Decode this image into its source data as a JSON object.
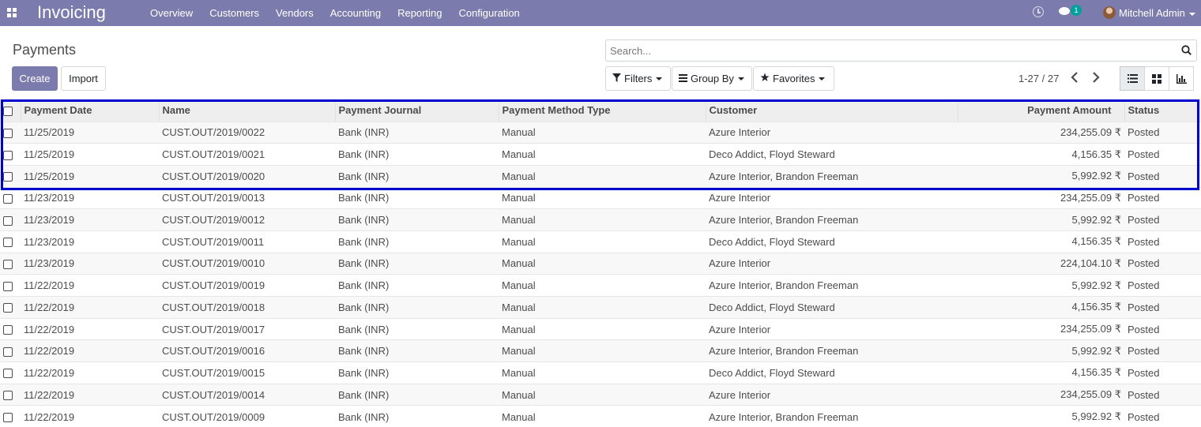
{
  "navbar": {
    "app_title": "Invoicing",
    "menu": [
      "Overview",
      "Customers",
      "Vendors",
      "Accounting",
      "Reporting",
      "Configuration"
    ],
    "chat_badge": "1",
    "user_name": "Mitchell Admin",
    "color": "#7c7bad"
  },
  "control": {
    "title": "Payments",
    "create_label": "Create",
    "import_label": "Import",
    "search_placeholder": "Search...",
    "filters_label": "Filters",
    "groupby_label": "Group By",
    "favorites_label": "Favorites",
    "pager": "1-27 / 27"
  },
  "table": {
    "columns": [
      "Payment Date",
      "Name",
      "Payment Journal",
      "Payment Method Type",
      "Customer",
      "Payment Amount",
      "Status"
    ],
    "rows": [
      [
        "11/25/2019",
        "CUST.OUT/2019/0022",
        "Bank (INR)",
        "Manual",
        "Azure Interior",
        "234,255.09 ₹",
        "Posted"
      ],
      [
        "11/25/2019",
        "CUST.OUT/2019/0021",
        "Bank (INR)",
        "Manual",
        "Deco Addict, Floyd Steward",
        "4,156.35 ₹",
        "Posted"
      ],
      [
        "11/25/2019",
        "CUST.OUT/2019/0020",
        "Bank (INR)",
        "Manual",
        "Azure Interior, Brandon Freeman",
        "5,992.92 ₹",
        "Posted"
      ],
      [
        "11/23/2019",
        "CUST.OUT/2019/0013",
        "Bank (INR)",
        "Manual",
        "Azure Interior",
        "234,255.09 ₹",
        "Posted"
      ],
      [
        "11/23/2019",
        "CUST.OUT/2019/0012",
        "Bank (INR)",
        "Manual",
        "Azure Interior, Brandon Freeman",
        "5,992.92 ₹",
        "Posted"
      ],
      [
        "11/23/2019",
        "CUST.OUT/2019/0011",
        "Bank (INR)",
        "Manual",
        "Deco Addict, Floyd Steward",
        "4,156.35 ₹",
        "Posted"
      ],
      [
        "11/23/2019",
        "CUST.OUT/2019/0010",
        "Bank (INR)",
        "Manual",
        "Azure Interior",
        "224,104.10 ₹",
        "Posted"
      ],
      [
        "11/22/2019",
        "CUST.OUT/2019/0019",
        "Bank (INR)",
        "Manual",
        "Azure Interior, Brandon Freeman",
        "5,992.92 ₹",
        "Posted"
      ],
      [
        "11/22/2019",
        "CUST.OUT/2019/0018",
        "Bank (INR)",
        "Manual",
        "Deco Addict, Floyd Steward",
        "4,156.35 ₹",
        "Posted"
      ],
      [
        "11/22/2019",
        "CUST.OUT/2019/0017",
        "Bank (INR)",
        "Manual",
        "Azure Interior",
        "234,255.09 ₹",
        "Posted"
      ],
      [
        "11/22/2019",
        "CUST.OUT/2019/0016",
        "Bank (INR)",
        "Manual",
        "Azure Interior, Brandon Freeman",
        "5,992.92 ₹",
        "Posted"
      ],
      [
        "11/22/2019",
        "CUST.OUT/2019/0015",
        "Bank (INR)",
        "Manual",
        "Deco Addict, Floyd Steward",
        "4,156.35 ₹",
        "Posted"
      ],
      [
        "11/22/2019",
        "CUST.OUT/2019/0014",
        "Bank (INR)",
        "Manual",
        "Azure Interior",
        "234,255.09 ₹",
        "Posted"
      ],
      [
        "11/22/2019",
        "CUST.OUT/2019/0009",
        "Bank (INR)",
        "Manual",
        "Azure Interior, Brandon Freeman",
        "5,992.92 ₹",
        "Posted"
      ]
    ]
  },
  "highlight_color": "#0000cc"
}
